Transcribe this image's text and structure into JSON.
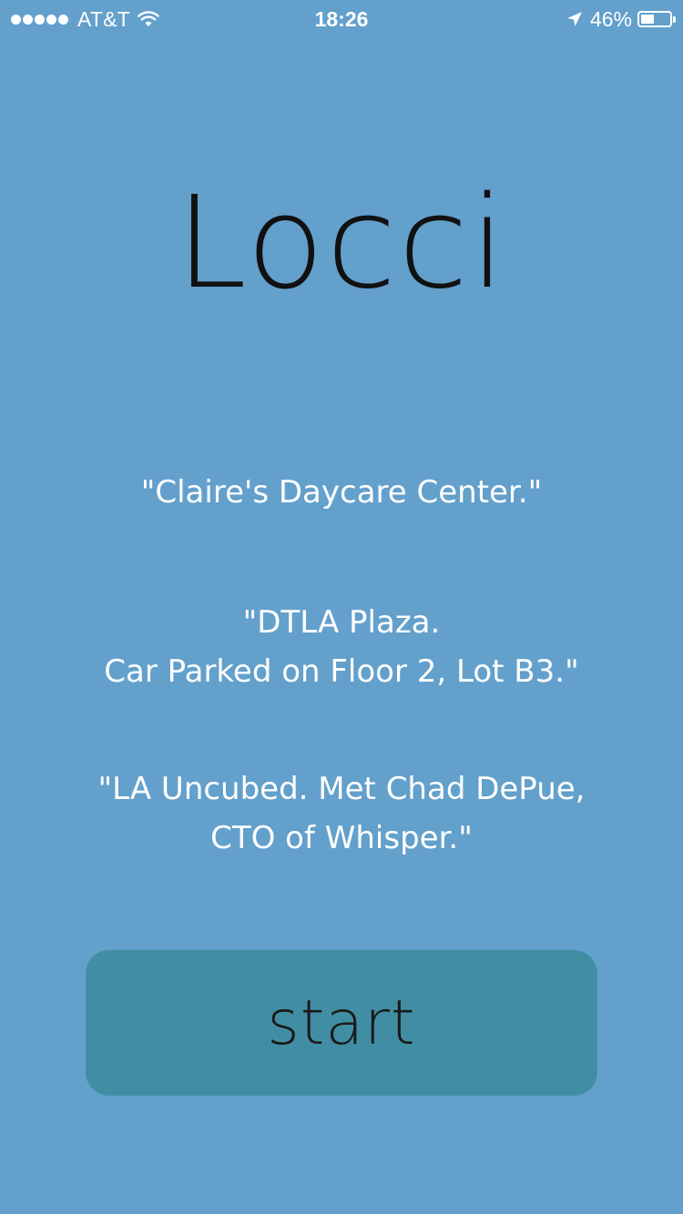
{
  "status_bar": {
    "carrier": "AT&T",
    "time": "18:26",
    "battery_percent_text": "46%",
    "battery_level": 0.46,
    "signal_strength": 5,
    "icons": [
      "signal-dots",
      "wifi-icon",
      "location-arrow-icon",
      "battery-icon"
    ]
  },
  "app": {
    "title": "Locci"
  },
  "quotes": [
    "\"Claire's Daycare Center.\"",
    "\"DTLA Plaza.\nCar Parked on Floor 2, Lot B3.\"",
    "\"LA Uncubed. Met Chad DePue,\nCTO of Whisper.\""
  ],
  "start_button": {
    "label": "start"
  },
  "colors": {
    "background": "#63a0cc",
    "button": "#418ea4",
    "title_text": "#111111",
    "quote_text": "#ffffff"
  }
}
